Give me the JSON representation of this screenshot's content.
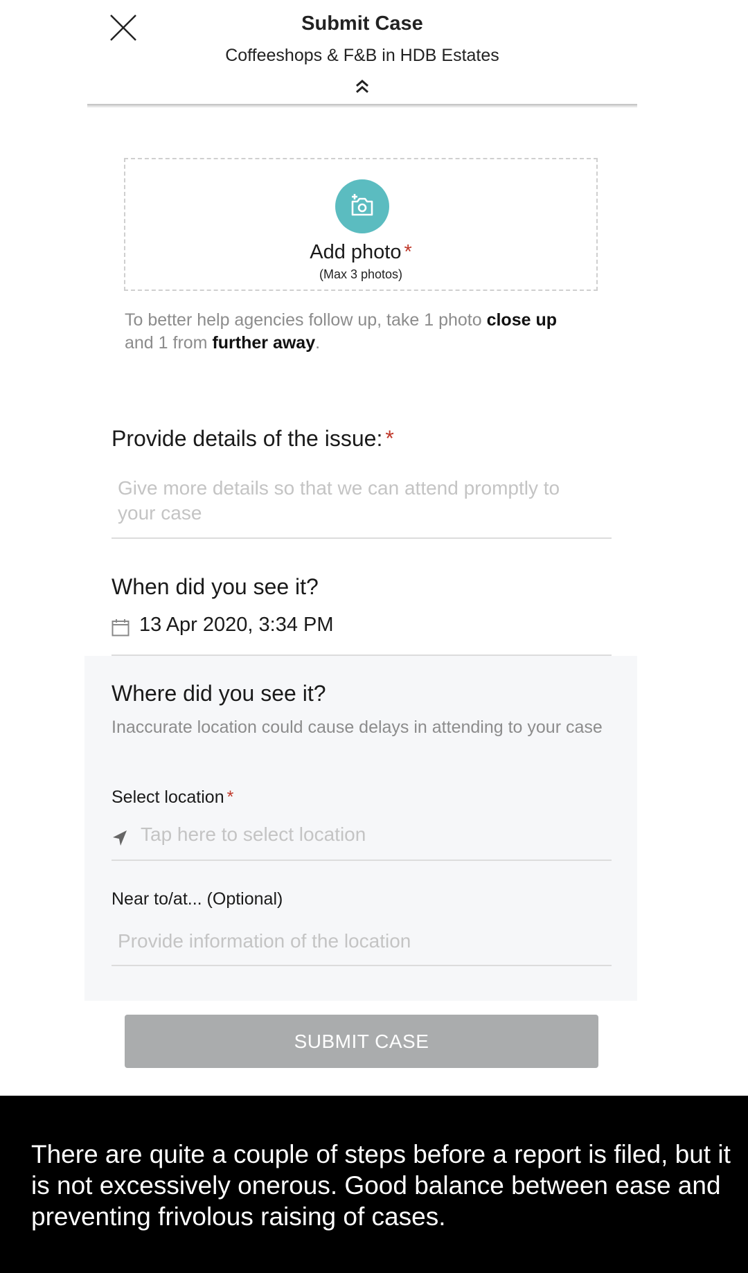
{
  "header": {
    "title": "Submit Case",
    "subtitle": "Coffeeshops & F&B in HDB Estates"
  },
  "photo": {
    "add_label": "Add photo",
    "required_mark": "*",
    "max_note": "(Max 3 photos)",
    "hint_part1": "To better help agencies follow up, take 1 photo ",
    "hint_bold1": "close up",
    "hint_part2": " and 1 from ",
    "hint_bold2": "further away",
    "hint_part3": "."
  },
  "details": {
    "label": "Provide details of the issue:",
    "required_mark": "*",
    "placeholder": "Give more details so that we can attend promptly to your case"
  },
  "when": {
    "label": "When did you see it?",
    "value": "13 Apr 2020, 3:34 PM"
  },
  "where": {
    "label": "Where did you see it?",
    "subtext": "Inaccurate location could cause delays in attending to your case",
    "select_label": "Select location",
    "required_mark": "*",
    "select_placeholder": "Tap here to select location",
    "near_label": "Near to/at... (Optional)",
    "near_placeholder": "Provide information of the location"
  },
  "submit": {
    "label": "SUBMIT CASE"
  },
  "caption": {
    "text": "There are quite a couple of steps before a report is filed, but it is not excessively onerous. Good balance between ease and preventing frivolous raising of cases."
  },
  "colors": {
    "accent": "#5bbcc0",
    "required": "#c0392b",
    "submit_disabled": "#aaacad",
    "section_bg": "#f6f7f9"
  },
  "icons": [
    "close-icon",
    "chevron-double-up-icon",
    "camera-add-icon",
    "calendar-icon",
    "location-arrow-icon"
  ]
}
